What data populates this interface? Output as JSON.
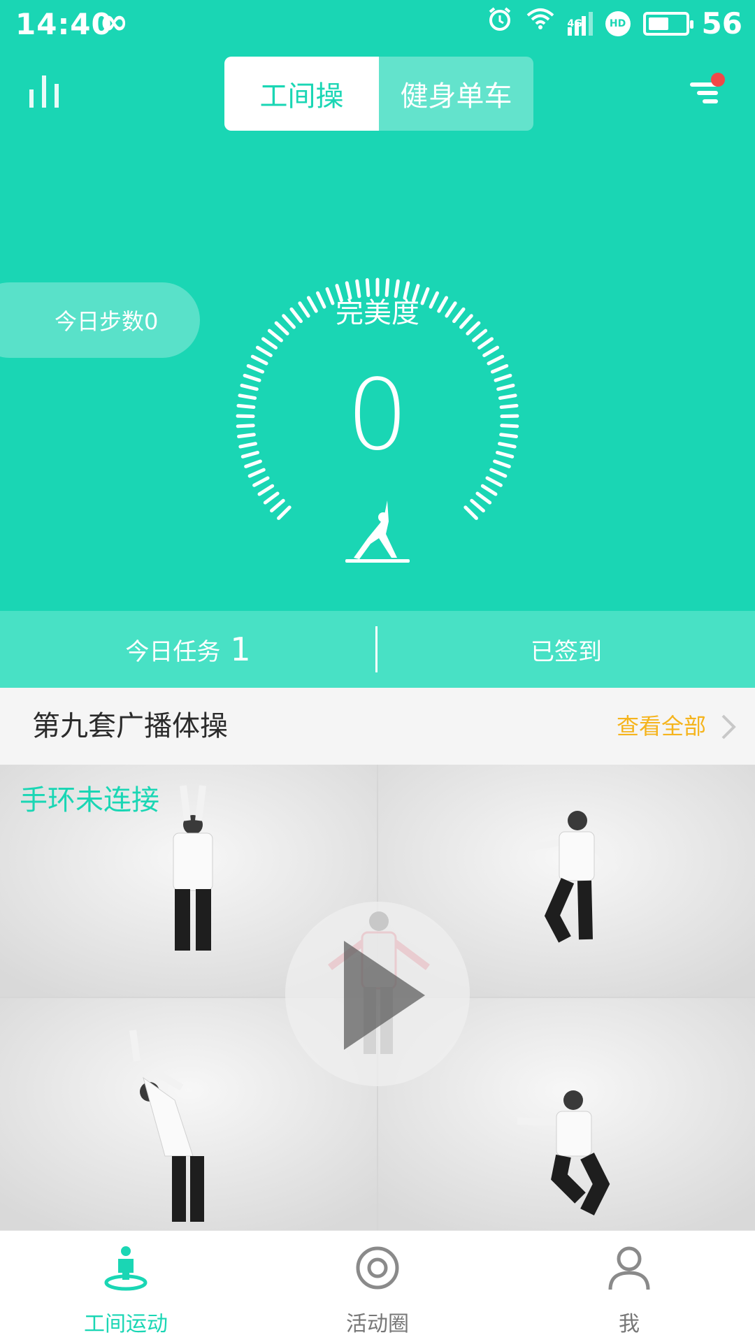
{
  "status_bar": {
    "time": "14:40",
    "infinity_glyph": "∞",
    "alarm_glyph": "⏰",
    "wifi_glyph": "📶",
    "network_label": "4G",
    "hd_label": "HD",
    "battery_level": "56",
    "battery_fraction": 0.56
  },
  "header": {
    "tabs": [
      {
        "label": "工间操",
        "active": true
      },
      {
        "label": "健身单车",
        "active": false
      }
    ],
    "left_icon": "bar-chart-icon",
    "right_icon": "menu-icon",
    "notification_dot_color": "#f04848"
  },
  "gauge": {
    "steps_label": "今日步数0",
    "title": "完美度",
    "value": "0",
    "icon": "yoga-icon"
  },
  "tasks": {
    "label": "今日任务",
    "count": "1",
    "status": "已签到"
  },
  "section": {
    "title": "第九套广播体操",
    "more_label": "查看全部"
  },
  "video": {
    "band_status": "手环未连接",
    "play_icon": "play-icon"
  },
  "tab_bar": {
    "items": [
      {
        "label": "工间运动",
        "icon": "person-pin-icon",
        "active": true
      },
      {
        "label": "活动圈",
        "icon": "target-icon",
        "active": false
      },
      {
        "label": "我",
        "icon": "user-icon",
        "active": false
      }
    ]
  },
  "colors": {
    "primary": "#1ad6b4",
    "task_bar": "#48e1c5",
    "link": "#f5b41d"
  }
}
